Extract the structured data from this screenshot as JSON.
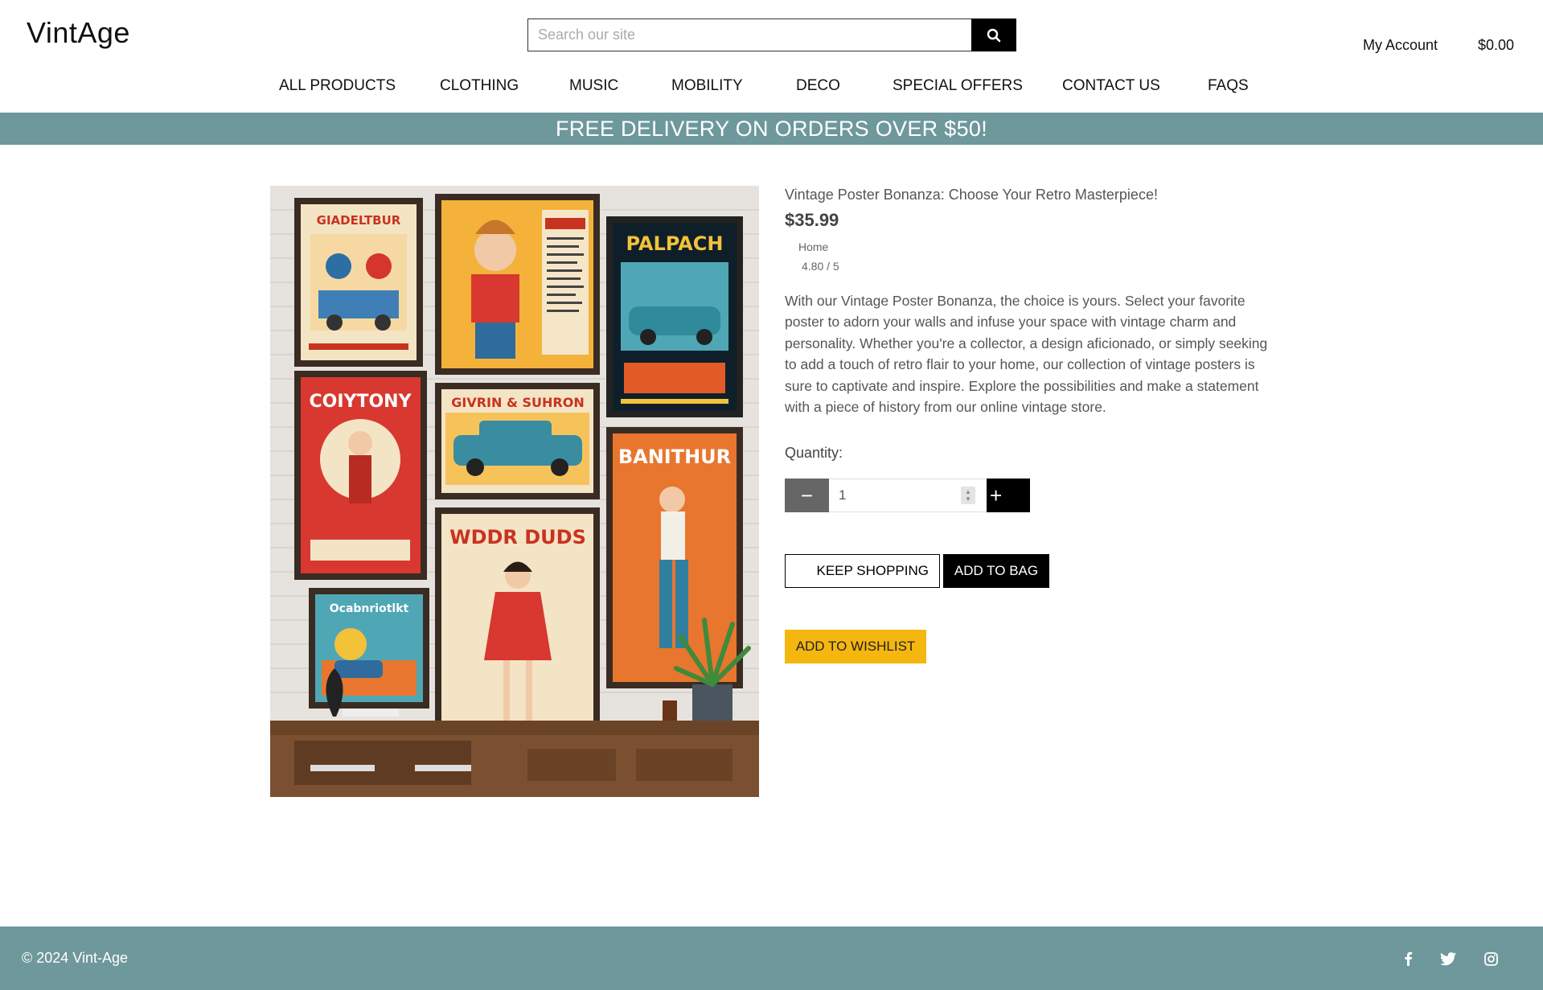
{
  "header": {
    "logo": "VintAge",
    "search_placeholder": "Search our site",
    "account_label": "My Account",
    "cart_total": "$0.00"
  },
  "nav": {
    "items": [
      "ALL PRODUCTS",
      "CLOTHING",
      "MUSIC",
      "MOBILITY",
      "DECO",
      "SPECIAL OFFERS",
      "CONTACT US",
      "FAQS"
    ]
  },
  "banner": {
    "text": "FREE DELIVERY ON ORDERS OVER $50!"
  },
  "product": {
    "title": "Vintage Poster Bonanza: Choose Your Retro Masterpiece!",
    "price": "$35.99",
    "category": "Home",
    "rating": "4.80 / 5",
    "description": "With our Vintage Poster Bonanza, the choice is yours. Select your favorite poster to adorn your walls and infuse your space with vintage charm and personality. Whether you're a collector, a design aficionado, or simply seeking to add a touch of retro flair to your home, our collection of vintage posters is sure to captivate and inspire. Explore the possibilities and make a statement with a piece of history from our online vintage store.",
    "quantity_label": "Quantity:",
    "quantity_value": "1",
    "minus_symbol": "−",
    "plus_symbol": "+",
    "keep_shopping_label": "KEEP SHOPPING",
    "add_to_bag_label": "ADD TO BAG",
    "add_to_wishlist_label": "ADD TO WISHLIST",
    "image": {
      "posters": [
        "GIADELTBUR",
        "PALPACH",
        "COIYTONY",
        "GIVRIN & SUHRON",
        "BANITHUR",
        "WDDR DUDS",
        "Ocabnriotlkt"
      ]
    }
  },
  "footer": {
    "copyright": "© 2024 Vint-Age",
    "social_icons": [
      "facebook-icon",
      "twitter-icon",
      "instagram-icon"
    ]
  },
  "colors": {
    "banner_bg": "#6e989b",
    "footer_bg": "#6e989b",
    "wishlist_button": "#f5b70f",
    "primary_button": "#000000"
  }
}
